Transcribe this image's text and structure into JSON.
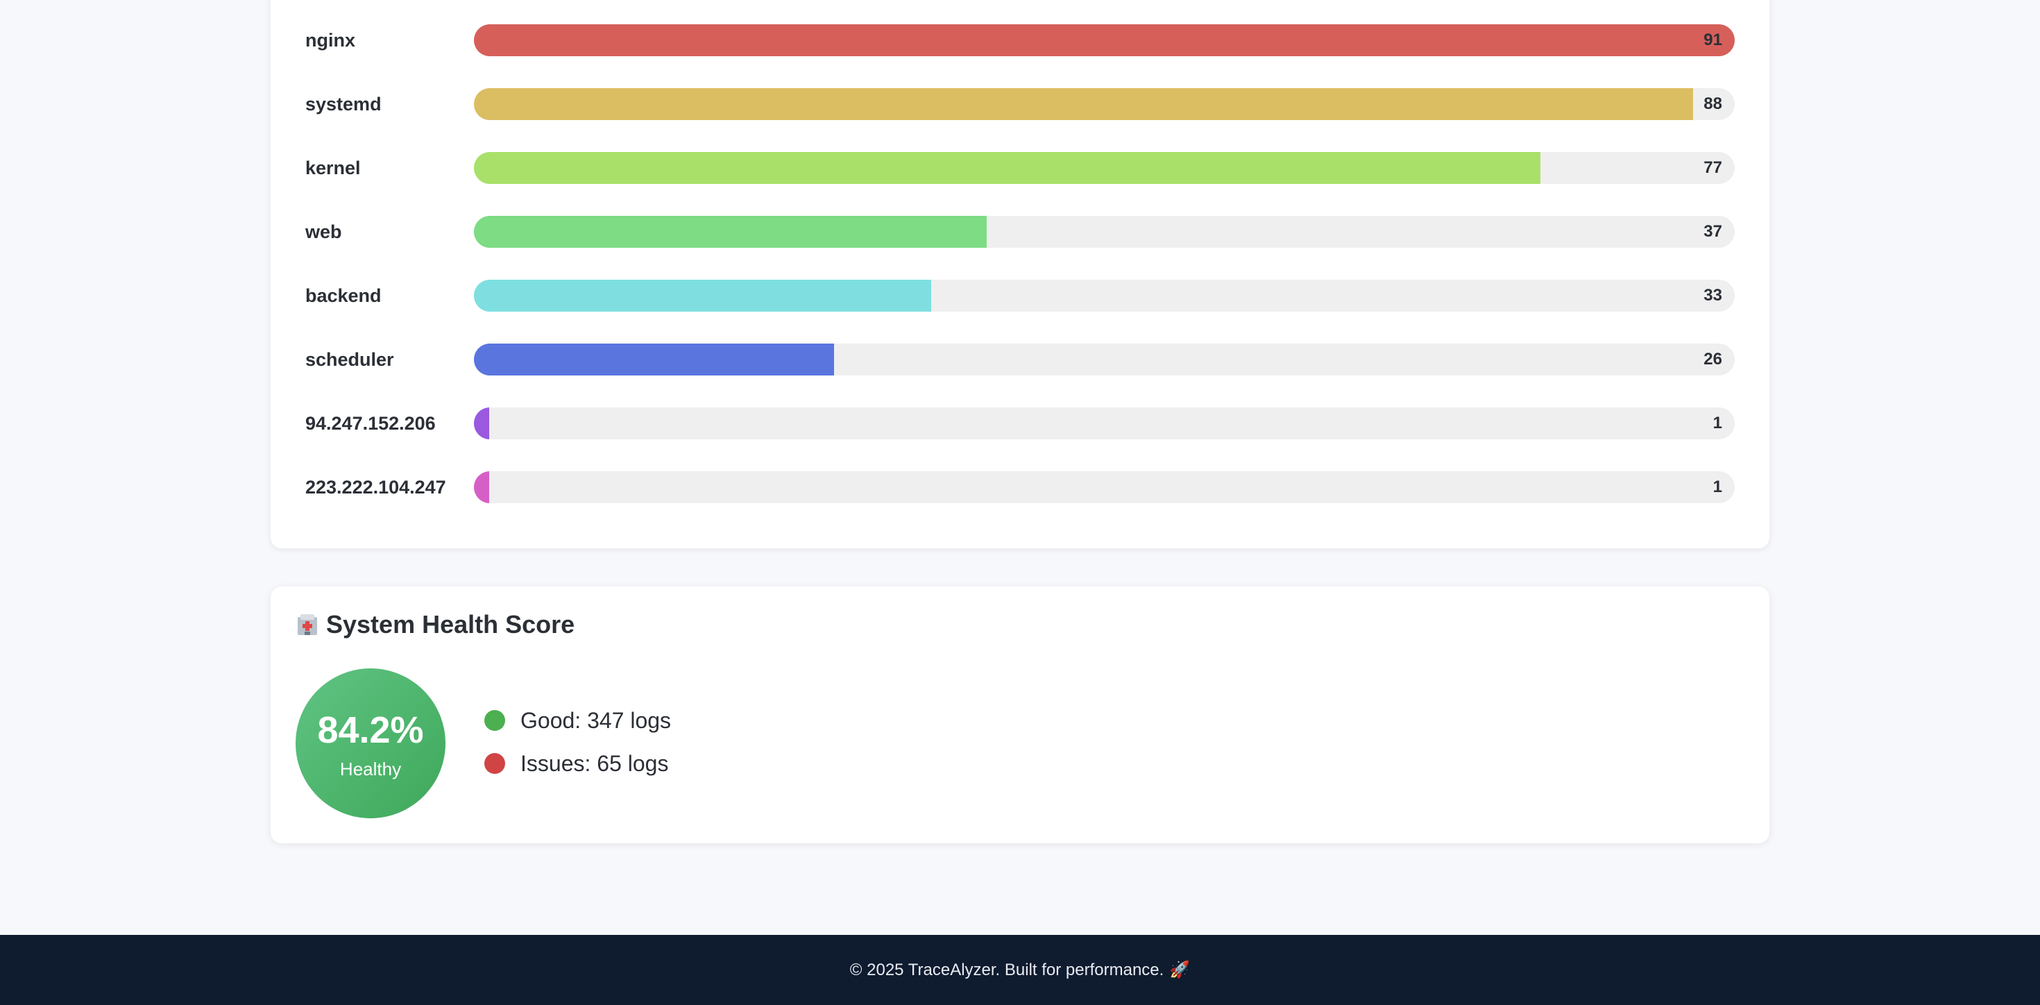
{
  "sources": {
    "max_value": 91,
    "items": [
      {
        "label": "nginx",
        "value": 91,
        "color": "#d65f5a"
      },
      {
        "label": "systemd",
        "value": 88,
        "color": "#dbbd62"
      },
      {
        "label": "kernel",
        "value": 77,
        "color": "#a9e06a"
      },
      {
        "label": "web",
        "value": 37,
        "color": "#7ddc84"
      },
      {
        "label": "backend",
        "value": 33,
        "color": "#7fdfe0"
      },
      {
        "label": "scheduler",
        "value": 26,
        "color": "#5a75de"
      },
      {
        "label": "94.247.152.206",
        "value": 1,
        "color": "#9a59de"
      },
      {
        "label": "223.222.104.247",
        "value": 1,
        "color": "#d65fc7"
      }
    ]
  },
  "health": {
    "title": "System Health Score",
    "icon": "hospital-icon",
    "score": "84.2%",
    "status": "Healthy",
    "good_label": "Good: 347 logs",
    "good_color": "#4caf50",
    "issues_label": "Issues: 65 logs",
    "issues_color": "#d04444"
  },
  "footer": {
    "text": "© 2025 TraceAlyzer. Built for performance.",
    "icon": "rocket-icon",
    "rocket": "🚀"
  }
}
